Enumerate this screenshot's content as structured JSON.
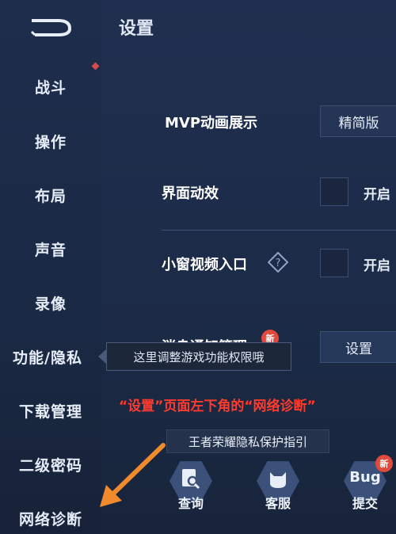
{
  "sidebar": {
    "items": [
      {
        "label": "战斗"
      },
      {
        "label": "操作"
      },
      {
        "label": "布局"
      },
      {
        "label": "声音"
      },
      {
        "label": "录像"
      },
      {
        "label": "功能/隐私"
      },
      {
        "label": "下载管理"
      },
      {
        "label": "二级密码"
      },
      {
        "label": "网络诊断"
      }
    ]
  },
  "header": {
    "title": "设置"
  },
  "settings": {
    "mvp_label": "MVP动画展示",
    "mvp_value": "精简版",
    "ui_anim_label": "界面动效",
    "ui_anim_toggle": "开启",
    "mini_window_label": "小窗视频入口",
    "mini_window_toggle": "开启",
    "msg_label": "消息通知管理",
    "msg_badge": "新",
    "msg_button": "设置"
  },
  "tooltip": {
    "text": "这里调整游戏功能权限哦"
  },
  "annotation": {
    "text": "“设置”页面左下角的“网络诊断”"
  },
  "privacy_link": {
    "label": "王者荣耀隐私保护指引"
  },
  "bottom": {
    "query": "查询",
    "service": "客服",
    "bug_title": "Bug",
    "bug": "提交",
    "bug_badge": "新"
  },
  "colors": {
    "accent_red": "#ff3b2f",
    "arrow_orange": "#f08a2c"
  }
}
